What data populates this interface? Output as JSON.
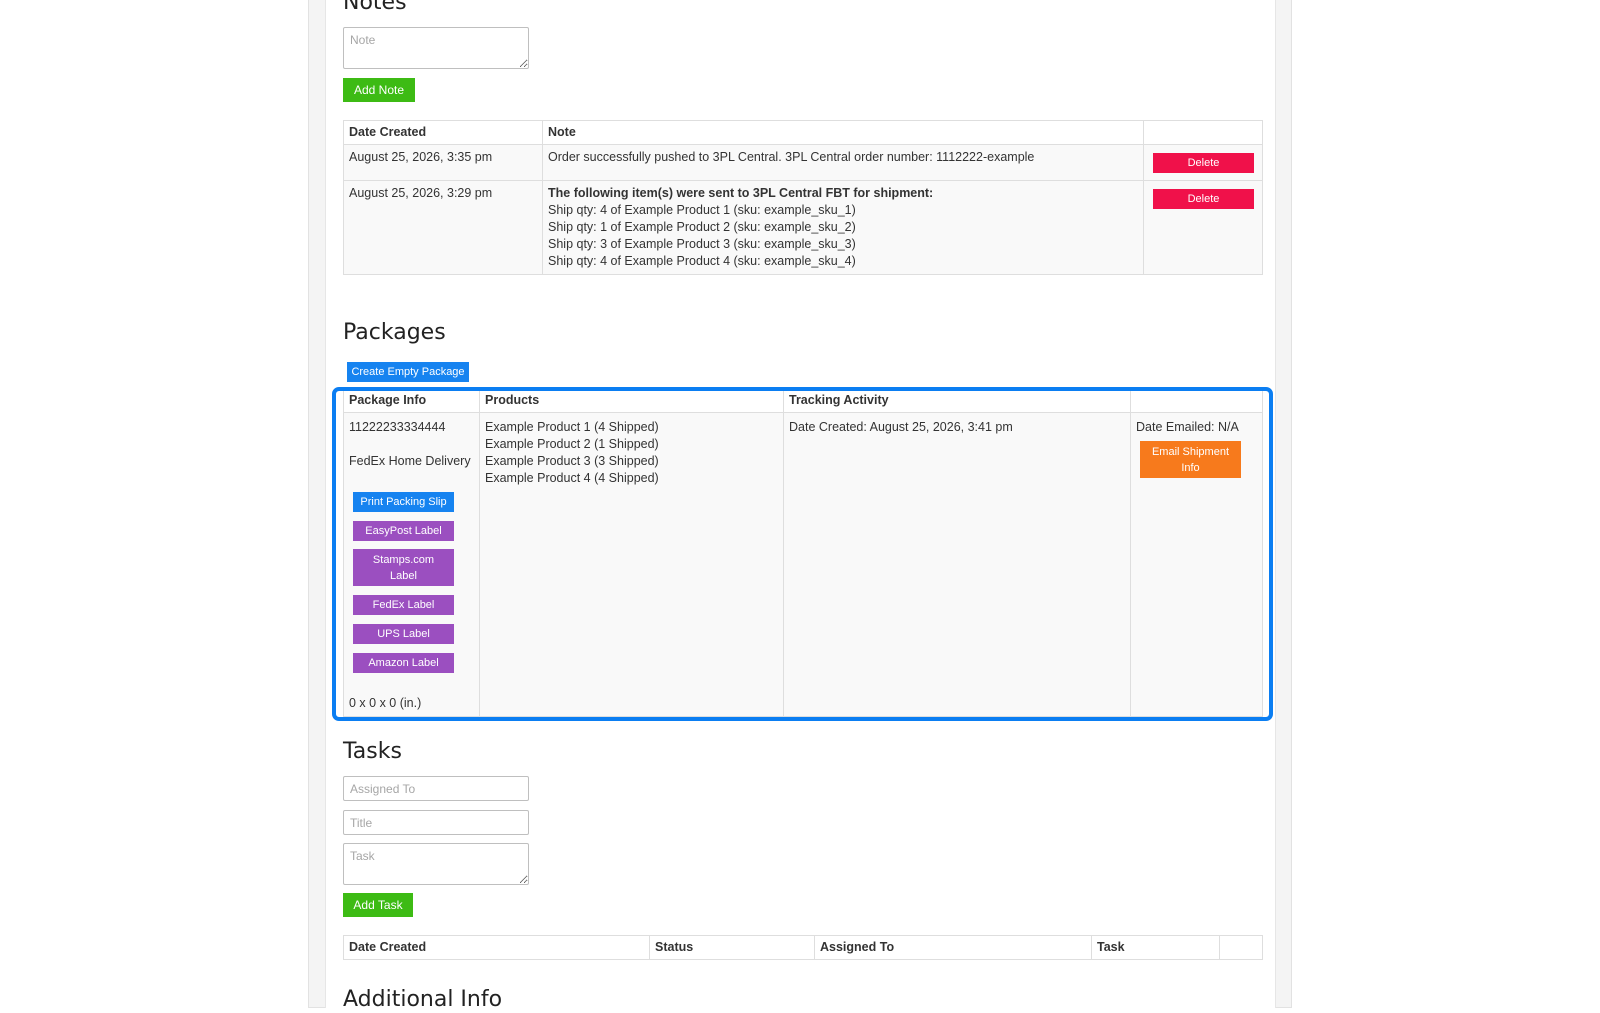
{
  "notes": {
    "heading": "Notes",
    "note_placeholder": "Note",
    "add_button": "Add Note",
    "columns": [
      "Date Created",
      "Note",
      ""
    ],
    "rows": [
      {
        "date": "August 25, 2026, 3:35 pm",
        "note_title": "",
        "note_lines": [
          "Order successfully pushed to 3PL Central. 3PL Central order number: 1112222-example"
        ],
        "delete_label": "Delete"
      },
      {
        "date": "August 25, 2026, 3:29 pm",
        "note_title": "The following item(s) were sent to 3PL Central FBT for shipment:",
        "note_lines": [
          "Ship qty: 4 of Example Product 1 (sku: example_sku_1)",
          "Ship qty: 1 of Example Product 2 (sku: example_sku_2)",
          "Ship qty: 3 of Example Product 3 (sku: example_sku_3)",
          "Ship qty: 4 of Example Product 4 (sku: example_sku_4)"
        ],
        "delete_label": "Delete"
      }
    ]
  },
  "packages": {
    "heading": "Packages",
    "create_button": "Create Empty Package",
    "columns": [
      "Package Info",
      "Products",
      "Tracking Activity",
      ""
    ],
    "package": {
      "tracking_number": "11222233334444",
      "carrier": "FedEx Home Delivery",
      "buttons": {
        "print_packing_slip": "Print Packing Slip",
        "easypost_label": "EasyPost Label",
        "stamps_label": "Stamps.com Label",
        "fedex_label": "FedEx Label",
        "ups_label": "UPS Label",
        "amazon_label": "Amazon Label"
      },
      "dimensions": "0 x 0 x 0 (in.)",
      "products": [
        "Example Product 1 (4 Shipped)",
        "Example Product 2 (1 Shipped)",
        "Example Product 3 (3 Shipped)",
        "Example Product 4 (4 Shipped)"
      ],
      "tracking_activity": "Date Created: August 25, 2026, 3:41 pm",
      "date_emailed": "Date Emailed: N/A",
      "email_button": "Email Shipment Info"
    }
  },
  "tasks": {
    "heading": "Tasks",
    "assigned_placeholder": "Assigned To",
    "title_placeholder": "Title",
    "task_placeholder": "Task",
    "add_button": "Add Task",
    "columns": [
      "Date Created",
      "Status",
      "Assigned To",
      "Task",
      ""
    ]
  },
  "additional": {
    "heading": "Additional Info"
  },
  "colors": {
    "highlight_border": "#0b7ef2",
    "green": "#3dbb14",
    "red": "#f0114a",
    "blue": "#1683f0",
    "purple": "#9b4fc0",
    "orange": "#f77a1c"
  }
}
